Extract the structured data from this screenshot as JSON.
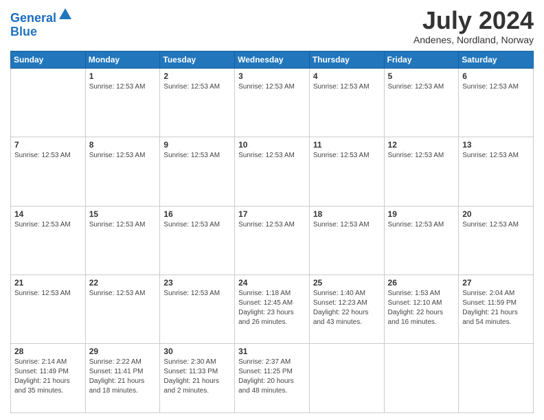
{
  "header": {
    "logo_line1": "General",
    "logo_line2": "Blue",
    "month_title": "July 2024",
    "location": "Andenes, Nordland, Norway"
  },
  "calendar": {
    "days_of_week": [
      "Sunday",
      "Monday",
      "Tuesday",
      "Wednesday",
      "Thursday",
      "Friday",
      "Saturday"
    ],
    "weeks": [
      [
        {
          "day": "",
          "info": ""
        },
        {
          "day": "1",
          "info": "Sunrise: 12:53 AM"
        },
        {
          "day": "2",
          "info": "Sunrise: 12:53 AM"
        },
        {
          "day": "3",
          "info": "Sunrise: 12:53 AM"
        },
        {
          "day": "4",
          "info": "Sunrise: 12:53 AM"
        },
        {
          "day": "5",
          "info": "Sunrise: 12:53 AM"
        },
        {
          "day": "6",
          "info": "Sunrise: 12:53 AM"
        }
      ],
      [
        {
          "day": "7",
          "info": "Sunrise: 12:53 AM"
        },
        {
          "day": "8",
          "info": "Sunrise: 12:53 AM"
        },
        {
          "day": "9",
          "info": "Sunrise: 12:53 AM"
        },
        {
          "day": "10",
          "info": "Sunrise: 12:53 AM"
        },
        {
          "day": "11",
          "info": "Sunrise: 12:53 AM"
        },
        {
          "day": "12",
          "info": "Sunrise: 12:53 AM"
        },
        {
          "day": "13",
          "info": "Sunrise: 12:53 AM"
        }
      ],
      [
        {
          "day": "14",
          "info": "Sunrise: 12:53 AM"
        },
        {
          "day": "15",
          "info": "Sunrise: 12:53 AM"
        },
        {
          "day": "16",
          "info": "Sunrise: 12:53 AM"
        },
        {
          "day": "17",
          "info": "Sunrise: 12:53 AM"
        },
        {
          "day": "18",
          "info": "Sunrise: 12:53 AM"
        },
        {
          "day": "19",
          "info": "Sunrise: 12:53 AM"
        },
        {
          "day": "20",
          "info": "Sunrise: 12:53 AM"
        }
      ],
      [
        {
          "day": "21",
          "info": "Sunrise: 12:53 AM"
        },
        {
          "day": "22",
          "info": "Sunrise: 12:53 AM"
        },
        {
          "day": "23",
          "info": "Sunrise: 12:53 AM"
        },
        {
          "day": "24",
          "info": "Sunrise: 1:18 AM\nSunset: 12:45 AM\nDaylight: 23 hours and 26 minutes."
        },
        {
          "day": "25",
          "info": "Sunrise: 1:40 AM\nSunset: 12:23 AM\nDaylight: 22 hours and 43 minutes."
        },
        {
          "day": "26",
          "info": "Sunrise: 1:53 AM\nSunset: 12:10 AM\nDaylight: 22 hours and 16 minutes."
        },
        {
          "day": "27",
          "info": "Sunrise: 2:04 AM\nSunset: 11:59 PM\nDaylight: 21 hours and 54 minutes."
        }
      ],
      [
        {
          "day": "28",
          "info": "Sunrise: 2:14 AM\nSunset: 11:49 PM\nDaylight: 21 hours and 35 minutes."
        },
        {
          "day": "29",
          "info": "Sunrise: 2:22 AM\nSunset: 11:41 PM\nDaylight: 21 hours and 18 minutes."
        },
        {
          "day": "30",
          "info": "Sunrise: 2:30 AM\nSunset: 11:33 PM\nDaylight: 21 hours and 2 minutes."
        },
        {
          "day": "31",
          "info": "Sunrise: 2:37 AM\nSunset: 11:25 PM\nDaylight: 20 hours and 48 minutes."
        },
        {
          "day": "",
          "info": ""
        },
        {
          "day": "",
          "info": ""
        },
        {
          "day": "",
          "info": ""
        }
      ]
    ]
  }
}
